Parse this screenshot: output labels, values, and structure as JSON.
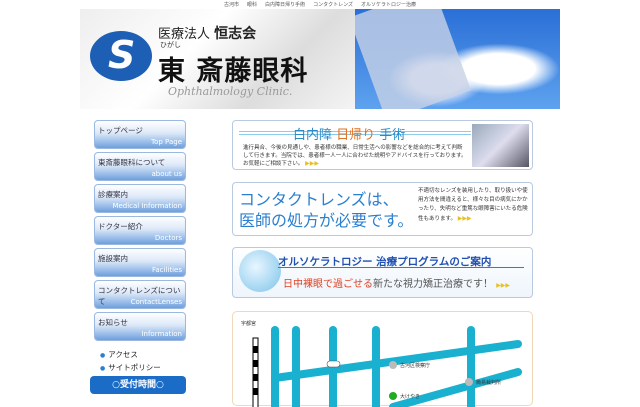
{
  "top_links": [
    "古河市",
    "眼科",
    "白内障日帰り手術",
    "コンタクトレンズ",
    "オルソケラトロジー治療"
  ],
  "header": {
    "corp": "医療法人",
    "corp_name": "恒志会",
    "furigana": "ひがし",
    "clinic_name": "東 斎藤眼科",
    "english": "Ophthalmology Clinic."
  },
  "nav": [
    {
      "jp": "トップページ",
      "en": "Top Page"
    },
    {
      "jp": "東斎藤眼科について",
      "en": "about us"
    },
    {
      "jp": "診療案内",
      "en": "Medical Information"
    },
    {
      "jp": "ドクター紹介",
      "en": "Doctors"
    },
    {
      "jp": "施設案内",
      "en": "Facilities"
    },
    {
      "jp": "コンタクトレンズについて",
      "en": "ContactLenses"
    },
    {
      "jp": "お知らせ",
      "en": "Information"
    }
  ],
  "links": [
    "アクセス",
    "サイトポリシー"
  ],
  "reception": "○受付時間○",
  "banner1": {
    "t1": "白内障 ",
    "t2": "日帰り",
    "t3": " 手術",
    "text": "進行具合、今後の見通しや、患者様の職業、日常生活への影響などを総合的に考えて判断して行きます。当院では、患者様一人一人に合わせた説明やアドバイスを行っております。お気軽にご相談下さい。",
    "arrows": "▶▶▶"
  },
  "banner2": {
    "title1": "コンタクトレンズは、",
    "title2": "医師の処方が必要です。",
    "text": "不適切なレンズを装用したり、取り扱いや使用方法を間違えると、様々な目の病気にかかったり、失明など重篤な眼障害にいたる危険性もあります。",
    "arrows": "▶▶▶"
  },
  "banner3": {
    "title": "オルソケラトロジー 治療プログラムのご案内",
    "sub1": "日中裸眼で過ごせる",
    "sub2": "新たな視力矯正治療です！",
    "arrows": "▶▶▶"
  },
  "map": {
    "labels": [
      "宇都宮",
      "古河区検察庁",
      "簡易裁判所",
      "大けやき"
    ]
  },
  "colors": {
    "accent": "#1b6cc6",
    "road": "#1ab0d0"
  }
}
